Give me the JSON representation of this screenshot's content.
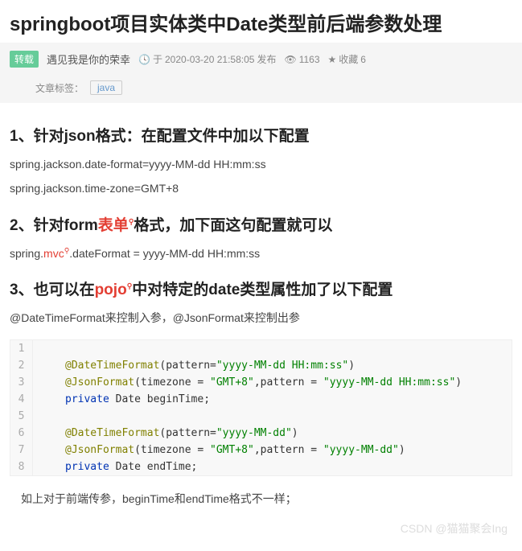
{
  "title": "springboot项目实体类中Date类型前后端参数处理",
  "meta": {
    "repost_badge": "转载",
    "author": "遇见我是你的荣幸",
    "time_prefix": "于 ",
    "timestamp": "2020-03-20 21:58:05",
    "time_suffix": " 发布",
    "views": "1163",
    "fav_label": "收藏",
    "fav_count": "6"
  },
  "tags": {
    "label": "文章标签：",
    "items": [
      "java"
    ]
  },
  "sections": {
    "h1": {
      "text": "1、针对json格式：在配置文件中加以下配置"
    },
    "p1a": "spring.jackson.date-format=yyyy-MM-dd HH:mm:ss",
    "p1b": "spring.jackson.time-zone=GMT+8",
    "h2": {
      "pre": "2、针对form",
      "hl": "表单",
      "post": "格式，加下面这句配置就可以"
    },
    "p2": {
      "pre": "spring.",
      "hl": "mvc",
      "post": ".dateFormat = yyyy-MM-dd HH:mm:ss"
    },
    "h3": {
      "pre": "3、也可以在",
      "hl": "pojo",
      "post": "中对特定的date类型属性加了以下配置"
    },
    "p3": "@DateTimeFormat来控制入参，@JsonFormat来控制出参"
  },
  "code": {
    "lines": [
      {
        "n": "1",
        "segments": []
      },
      {
        "n": "2",
        "segments": [
          {
            "t": "@DateTimeFormat",
            "c": "anno"
          },
          {
            "t": "(pattern=",
            "c": ""
          },
          {
            "t": "\"yyyy-MM-dd HH:mm:ss\"",
            "c": "str"
          },
          {
            "t": ")",
            "c": ""
          }
        ]
      },
      {
        "n": "3",
        "segments": [
          {
            "t": "@JsonFormat",
            "c": "anno"
          },
          {
            "t": "(timezone = ",
            "c": ""
          },
          {
            "t": "\"GMT+8\"",
            "c": "str"
          },
          {
            "t": ",pattern = ",
            "c": ""
          },
          {
            "t": "\"yyyy-MM-dd HH:mm:ss\"",
            "c": "str"
          },
          {
            "t": ")",
            "c": ""
          }
        ]
      },
      {
        "n": "4",
        "segments": [
          {
            "t": "private",
            "c": "kw"
          },
          {
            "t": " Date beginTime;",
            "c": ""
          }
        ]
      },
      {
        "n": "5",
        "segments": []
      },
      {
        "n": "6",
        "segments": [
          {
            "t": "@DateTimeFormat",
            "c": "anno"
          },
          {
            "t": "(pattern=",
            "c": ""
          },
          {
            "t": "\"yyyy-MM-dd\"",
            "c": "str"
          },
          {
            "t": ")",
            "c": ""
          }
        ]
      },
      {
        "n": "7",
        "segments": [
          {
            "t": "@JsonFormat",
            "c": "anno"
          },
          {
            "t": "(timezone = ",
            "c": ""
          },
          {
            "t": "\"GMT+8\"",
            "c": "str"
          },
          {
            "t": ",pattern = ",
            "c": ""
          },
          {
            "t": "\"yyyy-MM-dd\"",
            "c": "str"
          },
          {
            "t": ")",
            "c": ""
          }
        ]
      },
      {
        "n": "8",
        "segments": [
          {
            "t": "private",
            "c": "kw"
          },
          {
            "t": " Date endTime;",
            "c": ""
          }
        ]
      }
    ]
  },
  "footnote": "如上对于前端传参，beginTime和endTime格式不一样；",
  "watermark": "CSDN @猫猫聚会Ing"
}
